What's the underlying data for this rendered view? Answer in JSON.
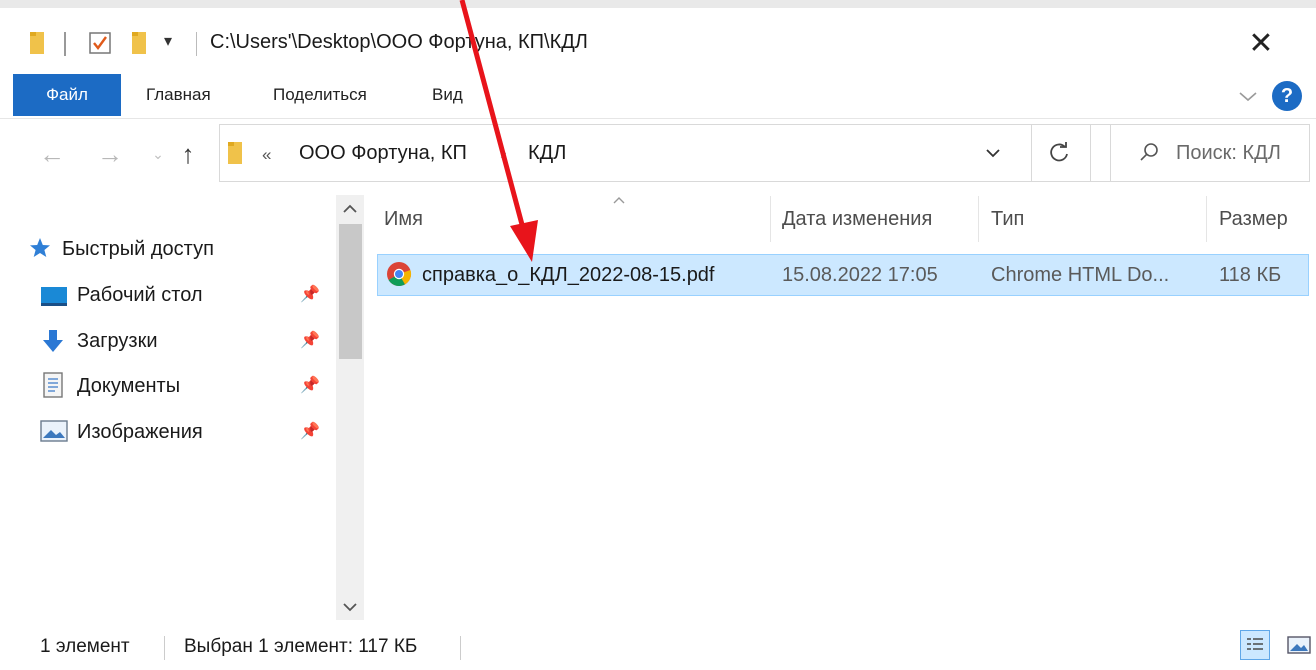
{
  "window": {
    "title_path": "C:\\Users'\\Desktop\\ООО Фортуна, КП\\КДЛ",
    "close_glyph": "✕"
  },
  "ribbon": {
    "tabs": [
      {
        "label": "Файл",
        "active": true
      },
      {
        "label": "Главная"
      },
      {
        "label": "Поделиться"
      },
      {
        "label": "Вид"
      }
    ],
    "help_glyph": "?"
  },
  "address_bar": {
    "overflow_glyph": "«",
    "crumbs": [
      "ООО Фортуна, КП",
      "КДЛ"
    ],
    "separator": "›"
  },
  "search": {
    "placeholder": "Поиск: КДЛ"
  },
  "sidebar": {
    "quick_access_label": "Быстрый доступ",
    "items": [
      {
        "label": "Рабочий стол",
        "icon": "desktop-icon",
        "pinned": true
      },
      {
        "label": "Загрузки",
        "icon": "downloads-icon",
        "pinned": true
      },
      {
        "label": "Документы",
        "icon": "documents-icon",
        "pinned": true
      },
      {
        "label": "Изображения",
        "icon": "pictures-icon",
        "pinned": true
      }
    ]
  },
  "file_list": {
    "columns": [
      "Имя",
      "Дата изменения",
      "Тип",
      "Размер"
    ],
    "rows": [
      {
        "name": "справка_о_КДЛ_2022-08-15.pdf",
        "modified": "15.08.2022 17:05",
        "type": "Chrome HTML Do...",
        "size": "118 КБ",
        "selected": true,
        "icon": "chrome-icon"
      }
    ]
  },
  "status_bar": {
    "count": "1 элемент",
    "selection": "Выбран 1 элемент: 117 КБ"
  },
  "colors": {
    "accent": "#1c6bc4",
    "selection_bg": "#cce8ff",
    "selection_border": "#99d1ff",
    "annotation_arrow": "#e8141b"
  }
}
